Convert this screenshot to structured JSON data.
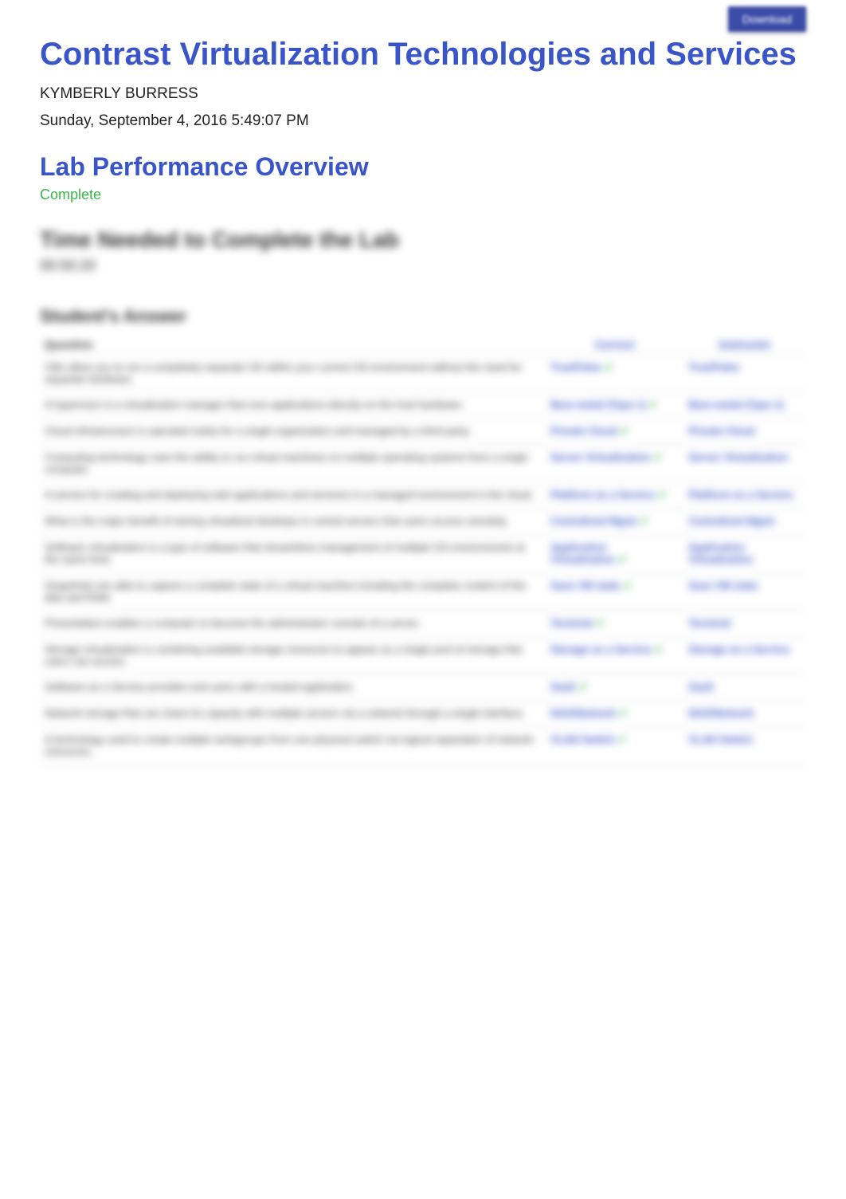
{
  "topButton": "Download",
  "title": "Contrast Virtualization Technologies and Services",
  "author": "KYMBERLY BURRESS",
  "date": "Sunday, September 4, 2016 5:49:07 PM",
  "sectionHeading": "Lab Performance Overview",
  "status": "Complete",
  "timeHeading": "Time Needed to Complete the Lab",
  "timeValue": "00:50:20",
  "answersHeading": "Student's Answer",
  "tableHeaders": {
    "question": "Question",
    "correct": "Correct",
    "instructor": "Instructor"
  },
  "rows": [
    {
      "q": "VMs allow you to run a completely separate OS within your current OS environment without the need for separate hardware.",
      "c": "True/False",
      "i": "True/False"
    },
    {
      "q": "A hypervisor is a virtualization manager that runs applications directly on the host hardware.",
      "c": "Bare-metal (Type 1)",
      "i": "Bare-metal (Type 1)"
    },
    {
      "q": "Cloud infrastructure is operated solely for a single organization and managed by a third party.",
      "c": "Private Cloud",
      "i": "Private Cloud"
    },
    {
      "q": "Computing technology uses the ability to run virtual machines on multiple operating systems from a single computer.",
      "c": "Server Virtualization",
      "i": "Server Virtualization"
    },
    {
      "q": "A service for creating and deploying web applications and services in a managed environment in the cloud.",
      "c": "Platform as a Service",
      "i": "Platform as a Service"
    },
    {
      "q": "What is the major benefit of storing virtualized desktops in central servers that users access remotely.",
      "c": "Centralized Mgmt",
      "i": "Centralized Mgmt"
    },
    {
      "q": "Software virtualization is a type of software that streamlines management of multiple OS environments at the same time.",
      "c": "Application Virtualization",
      "i": "Application Virtualization"
    },
    {
      "q": "Snapshots are able to capture a complete state of a virtual machine including the complete content of the disk and RAM.",
      "c": "Save VM state",
      "i": "Save VM state"
    },
    {
      "q": "Presentation enables a computer to become the administrator console of a server.",
      "c": "Terminal",
      "i": "Terminal"
    },
    {
      "q": "Storage virtualization is combining available storage resources to appear as a single pool of storage that users can access.",
      "c": "Storage as a Service",
      "i": "Storage as a Service"
    },
    {
      "q": "Software as a Service provides end users with a hosted application.",
      "c": "SaaS",
      "i": "SaaS"
    },
    {
      "q": "Network storage that can share its capacity with multiple servers via a network through a single interface.",
      "c": "NAS/Network",
      "i": "NAS/Network"
    },
    {
      "q": "A technology used to create multiple workgroups from one physical switch via logical separation of network resources.",
      "c": "VLAN Switch",
      "i": "VLAN Switch"
    }
  ]
}
